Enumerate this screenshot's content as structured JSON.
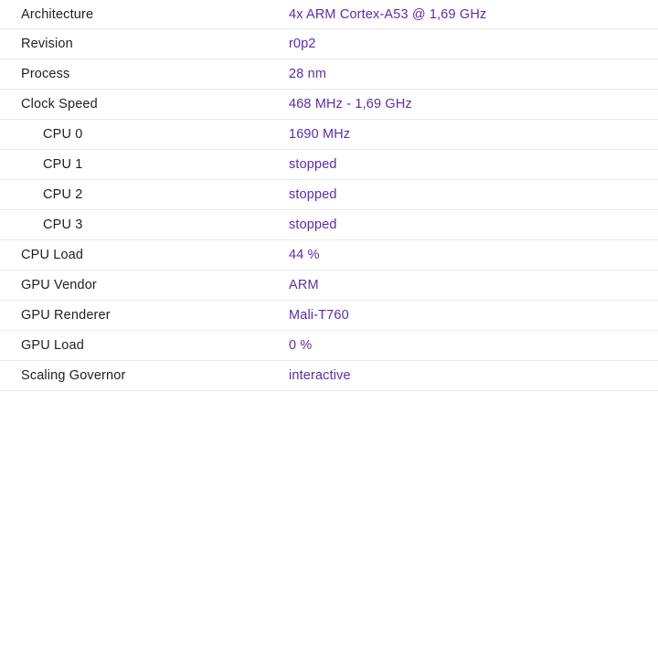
{
  "theme": {
    "background": "#ffffff",
    "label_color": "#1f1f1f",
    "value_color": "#5e2ca5",
    "divider_color": "#e9e9e9"
  },
  "info_table": {
    "rows": [
      {
        "label": "Architecture",
        "value": "4x ARM Cortex-A53 @ 1,69 GHz",
        "indent": false
      },
      {
        "label": "Revision",
        "value": "r0p2",
        "indent": false
      },
      {
        "label": "Process",
        "value": "28 nm",
        "indent": false
      },
      {
        "label": "Clock Speed",
        "value": "468 MHz - 1,69 GHz",
        "indent": false
      },
      {
        "label": "CPU 0",
        "value": "1690 MHz",
        "indent": true
      },
      {
        "label": "CPU 1",
        "value": "stopped",
        "indent": true
      },
      {
        "label": "CPU 2",
        "value": "stopped",
        "indent": true
      },
      {
        "label": "CPU 3",
        "value": "stopped",
        "indent": true
      },
      {
        "label": "CPU Load",
        "value": "44 %",
        "indent": false
      },
      {
        "label": "GPU Vendor",
        "value": "ARM",
        "indent": false
      },
      {
        "label": "GPU Renderer",
        "value": "Mali-T760",
        "indent": false
      },
      {
        "label": "GPU Load",
        "value": "0 %",
        "indent": false
      },
      {
        "label": "Scaling Governor",
        "value": "interactive",
        "indent": false
      }
    ]
  }
}
